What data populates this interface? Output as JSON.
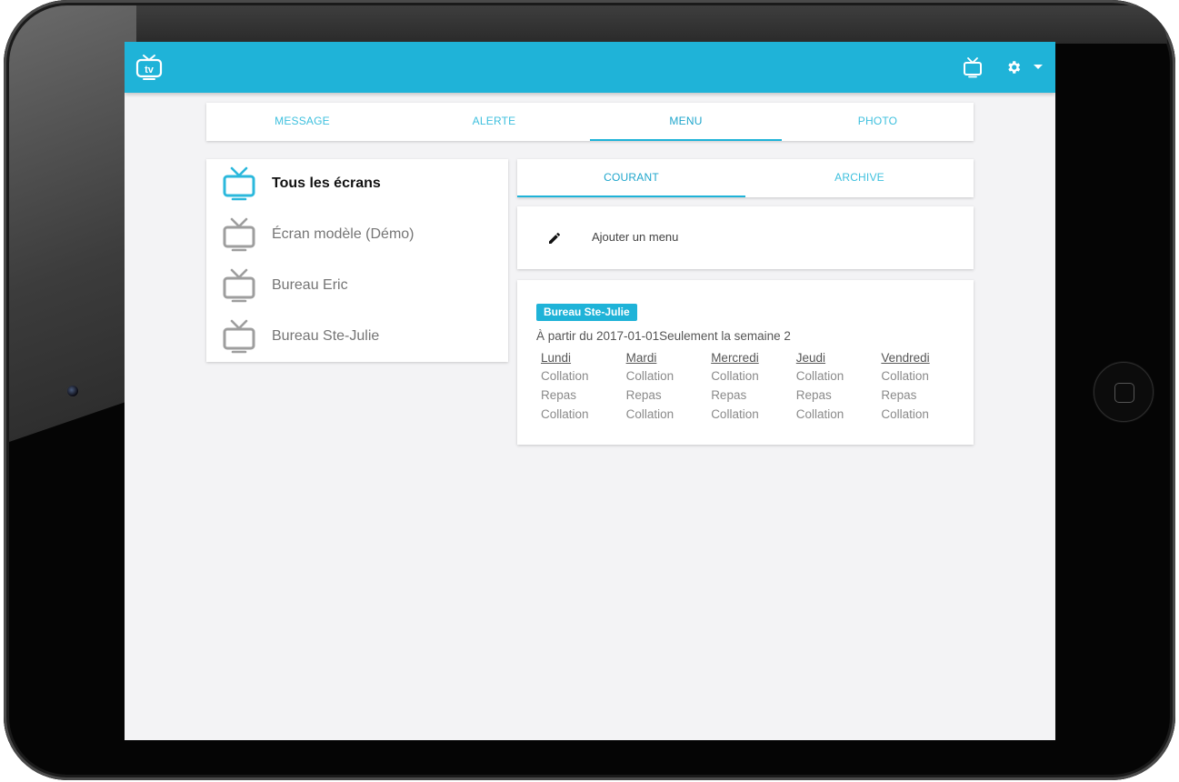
{
  "header": {
    "logo_text": "tv",
    "brand_color": "#1fb3d8"
  },
  "tabs": [
    {
      "label": "MESSAGE",
      "active": false
    },
    {
      "label": "ALERTE",
      "active": false
    },
    {
      "label": "MENU",
      "active": true
    },
    {
      "label": "PHOTO",
      "active": false
    }
  ],
  "screens": [
    {
      "label": "Tous les écrans",
      "active": true
    },
    {
      "label": "Écran modèle (Démo)",
      "active": false
    },
    {
      "label": "Bureau Eric",
      "active": false
    },
    {
      "label": "Bureau Ste-Julie",
      "active": false
    }
  ],
  "subtabs": [
    {
      "label": "COURANT",
      "active": true
    },
    {
      "label": "ARCHIVE",
      "active": false
    }
  ],
  "add_menu": {
    "label": "Ajouter un menu",
    "icon": "pencil-icon"
  },
  "menu_entry": {
    "screen_badge": "Bureau Ste-Julie",
    "range": "À partir du 2017-01-01Seulement la semaine 2",
    "days": [
      {
        "name": "Lundi",
        "meals": [
          "Collation",
          "Repas",
          "Collation"
        ]
      },
      {
        "name": "Mardi",
        "meals": [
          "Collation",
          "Repas",
          "Collation"
        ]
      },
      {
        "name": "Mercredi",
        "meals": [
          "Collation",
          "Repas",
          "Collation"
        ]
      },
      {
        "name": "Jeudi",
        "meals": [
          "Collation",
          "Repas",
          "Collation"
        ]
      },
      {
        "name": "Vendredi",
        "meals": [
          "Collation",
          "Repas",
          "Collation"
        ]
      }
    ]
  }
}
